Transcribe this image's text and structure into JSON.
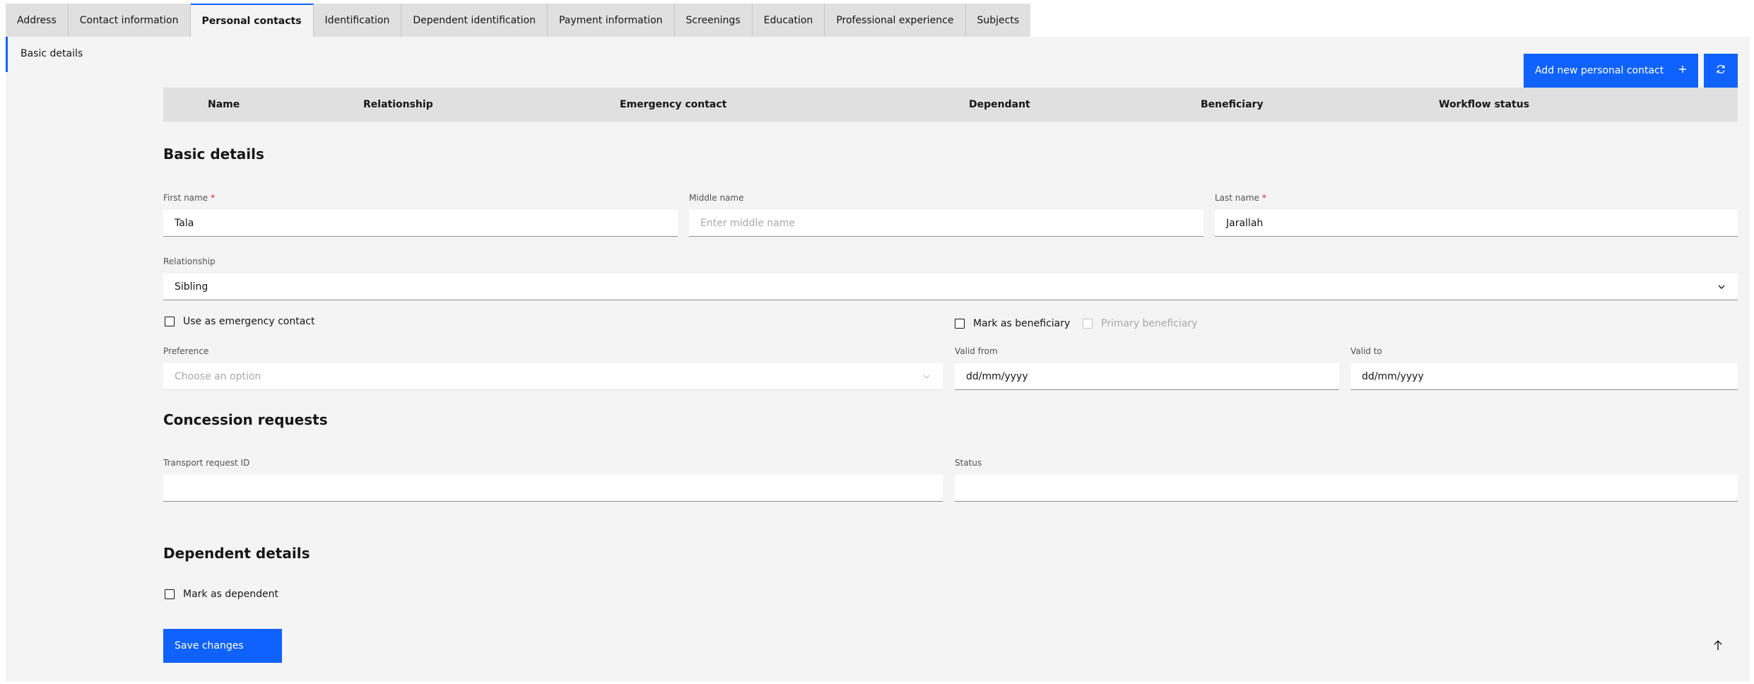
{
  "tabs": [
    {
      "label": "Address",
      "active": false
    },
    {
      "label": "Contact information",
      "active": false
    },
    {
      "label": "Personal contacts",
      "active": true
    },
    {
      "label": "Identification",
      "active": false
    },
    {
      "label": "Dependent identification",
      "active": false
    },
    {
      "label": "Payment information",
      "active": false
    },
    {
      "label": "Screenings",
      "active": false
    },
    {
      "label": "Education",
      "active": false
    },
    {
      "label": "Professional experience",
      "active": false
    },
    {
      "label": "Subjects",
      "active": false
    }
  ],
  "side_nav": {
    "item": "Basic details"
  },
  "toolbar": {
    "add_label": "Add new personal contact",
    "add_icon": "plus-icon",
    "refresh_icon": "refresh-icon"
  },
  "table": {
    "columns": [
      "Name",
      "Relationship",
      "Emergency contact",
      "Dependant",
      "Beneficiary",
      "Workflow status"
    ]
  },
  "basic": {
    "title": "Basic details",
    "first_name": {
      "label": "First name",
      "value": "Tala"
    },
    "middle_name": {
      "label": "Middle name",
      "placeholder": "Enter middle name"
    },
    "last_name": {
      "label": "Last name",
      "value": "Jarallah"
    },
    "relationship": {
      "label": "Relationship",
      "value": "Sibling"
    },
    "emergency_contact": {
      "label": "Use as emergency contact",
      "checked": false
    },
    "mark_beneficiary": {
      "label": "Mark as beneficiary",
      "checked": false
    },
    "primary_beneficiary": {
      "label": "Primary beneficiary",
      "checked": false,
      "disabled": true
    },
    "preference": {
      "label": "Preference",
      "placeholder": "Choose an option"
    },
    "valid_from": {
      "label": "Valid from",
      "placeholder": "dd/mm/yyyy"
    },
    "valid_to": {
      "label": "Valid to",
      "placeholder": "dd/mm/yyyy"
    }
  },
  "concession": {
    "title": "Concession requests",
    "transport_id": {
      "label": "Transport request ID",
      "value": ""
    },
    "status": {
      "label": "Status",
      "value": ""
    }
  },
  "dependent": {
    "title": "Dependent details",
    "mark_dependent": {
      "label": "Mark as dependent",
      "checked": false
    }
  },
  "footer": {
    "save_label": "Save changes",
    "top_icon": "arrow-up-icon"
  },
  "colors": {
    "accent": "#0f62fe",
    "panel": "#f4f4f4",
    "tab_bg": "#e0e0e0",
    "required": "#da1e28"
  }
}
